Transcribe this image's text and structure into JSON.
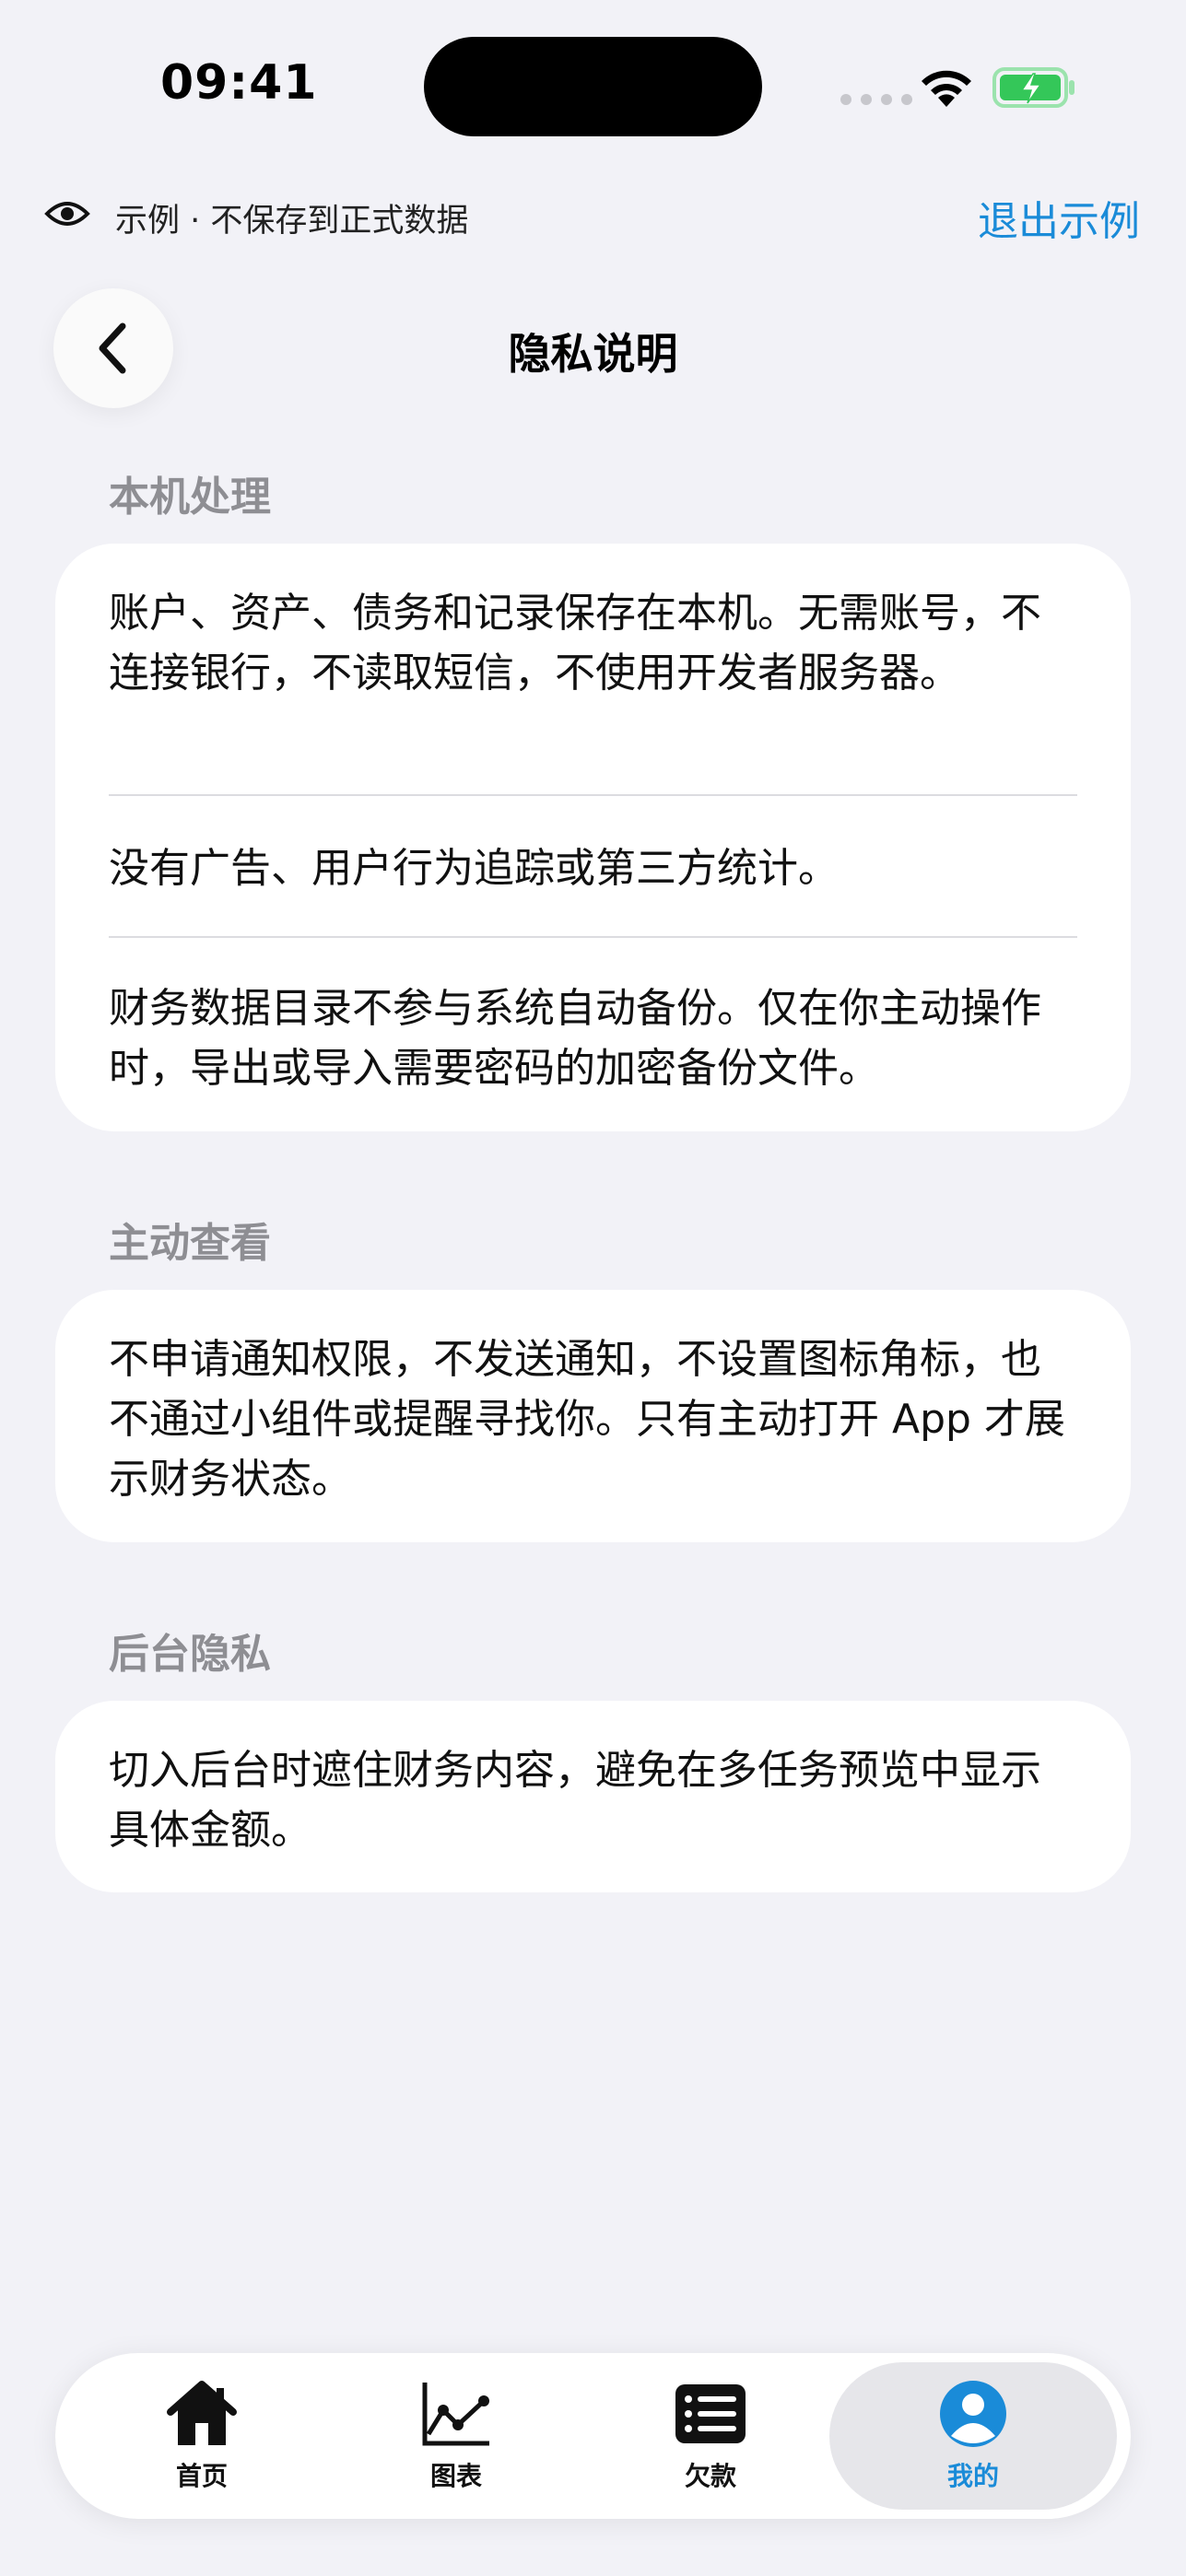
{
  "status_bar": {
    "time": "09:41"
  },
  "demo_banner": {
    "text": "示例 · 不保存到正式数据",
    "exit_label": "退出示例"
  },
  "header": {
    "title": "隐私说明"
  },
  "sections": [
    {
      "title": "本机处理",
      "items": [
        "账户、资产、债务和记录保存在本机。无需账号，不连接银行，不读取短信，不使用开发者服务器。",
        "没有广告、用户行为追踪或第三方统计。",
        "财务数据目录不参与系统自动备份。仅在你主动操作时，导出或导入需要密码的加密备份文件。"
      ]
    },
    {
      "title": "主动查看",
      "items": [
        "不申请通知权限，不发送通知，不设置图标角标，也不通过小组件或提醒寻找你。只有主动打开 App 才展示财务状态。"
      ]
    },
    {
      "title": "后台隐私",
      "items": [
        "切入后台时遮住财务内容，避免在多任务预览中显示具体金额。"
      ]
    }
  ],
  "tab_bar": {
    "tabs": [
      {
        "label": "首页",
        "icon": "home-icon"
      },
      {
        "label": "图表",
        "icon": "chart-icon"
      },
      {
        "label": "欠款",
        "icon": "list-icon"
      },
      {
        "label": "我的",
        "icon": "profile-icon"
      }
    ],
    "active": "我的"
  },
  "colors": {
    "accent": "#1a8bd8",
    "background": "#f2f2f7",
    "battery": "#34c759"
  }
}
